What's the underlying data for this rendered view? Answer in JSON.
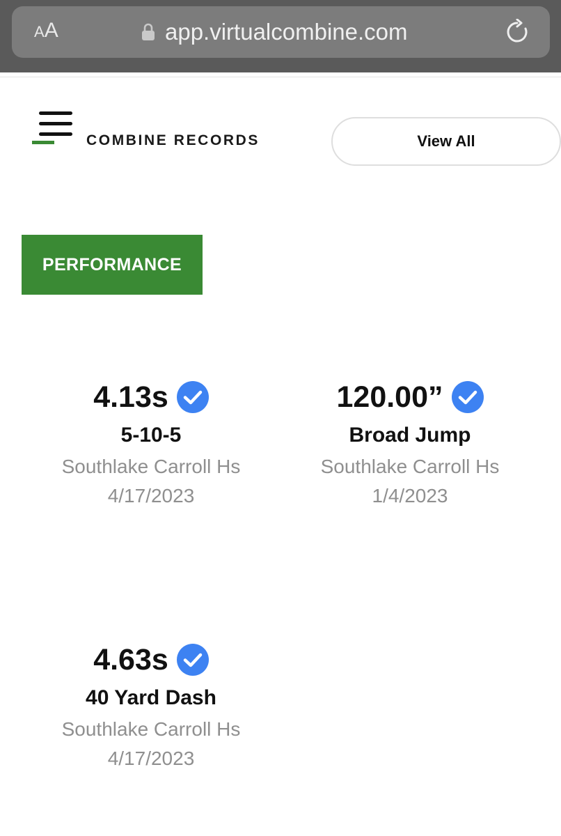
{
  "browser": {
    "aa_small": "A",
    "aa_big": "A",
    "url": "app.virtualcombine.com",
    "icons": {
      "lock": "lock-icon",
      "reload": "reload-icon"
    }
  },
  "header": {
    "title": "COMBINE RECORDS",
    "view_all_label": "View All",
    "menu_icon": "hamburger-menu-icon"
  },
  "section": {
    "badge_label": "PERFORMANCE"
  },
  "records": [
    {
      "value": "4.13s",
      "event": "5-10-5",
      "school": "Southlake Carroll Hs",
      "date": "4/17/2023",
      "verified": true
    },
    {
      "value": "120.00”",
      "event": "Broad Jump",
      "school": "Southlake Carroll Hs",
      "date": "1/4/2023",
      "verified": true
    },
    {
      "value": "4.63s",
      "event": "40 Yard Dash",
      "school": "Southlake Carroll Hs",
      "date": "4/17/2023",
      "verified": true
    }
  ],
  "colors": {
    "accent_green": "#3a8a34",
    "verified_blue": "#3d82f2",
    "muted_text": "#8f8f8f",
    "browser_bar": "#5a5a5a"
  }
}
